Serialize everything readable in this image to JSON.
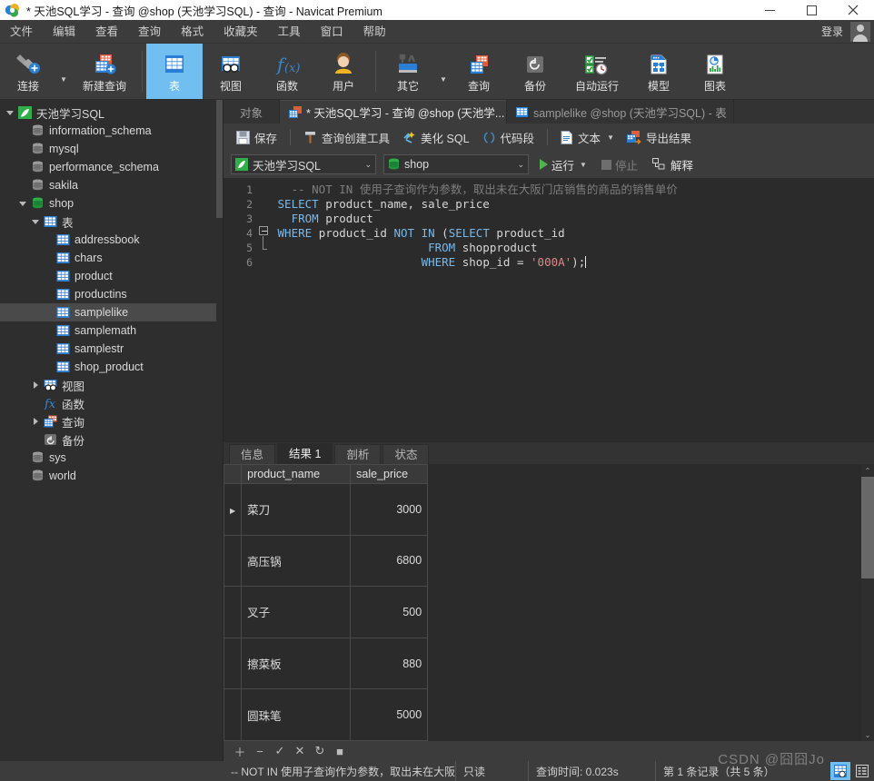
{
  "window": {
    "title": "* 天池SQL学习 - 查询 @shop (天池学习SQL) - 查询 - Navicat Premium",
    "minimize_label": "—",
    "maximize_label": "☐",
    "close_label": "✕"
  },
  "menubar": {
    "items": [
      {
        "label": "文件"
      },
      {
        "label": "编辑"
      },
      {
        "label": "查看"
      },
      {
        "label": "查询"
      },
      {
        "label": "格式"
      },
      {
        "label": "收藏夹"
      },
      {
        "label": "工具"
      },
      {
        "label": "窗口"
      },
      {
        "label": "帮助"
      }
    ],
    "login_label": "登录"
  },
  "main_toolbar": {
    "items": [
      {
        "label": "连接",
        "icon": "connection-icon",
        "has_caret": true,
        "active": false
      },
      {
        "label": "新建查询",
        "icon": "new-query-icon",
        "has_caret": false,
        "active": false
      },
      {
        "label": "表",
        "icon": "table-icon",
        "has_caret": false,
        "active": true
      },
      {
        "label": "视图",
        "icon": "view-icon",
        "has_caret": false,
        "active": false
      },
      {
        "label": "函数",
        "icon": "function-icon",
        "has_caret": false,
        "active": false
      },
      {
        "label": "用户",
        "icon": "user-icon",
        "has_caret": false,
        "active": false
      },
      {
        "label": "其它",
        "icon": "other-icon",
        "has_caret": true,
        "active": false
      },
      {
        "label": "查询",
        "icon": "query-icon",
        "has_caret": false,
        "active": false
      },
      {
        "label": "备份",
        "icon": "backup-icon",
        "has_caret": false,
        "active": false
      },
      {
        "label": "自动运行",
        "icon": "automation-icon",
        "has_caret": false,
        "active": false
      },
      {
        "label": "模型",
        "icon": "model-icon",
        "has_caret": false,
        "active": false
      },
      {
        "label": "图表",
        "icon": "chart-icon",
        "has_caret": false,
        "active": false
      }
    ]
  },
  "sidebar": {
    "tree": [
      {
        "label": "天池学习SQL",
        "depth": 0,
        "icon": "connection-leaf-icon",
        "twisty": "open",
        "selected": false
      },
      {
        "label": "information_schema",
        "depth": 1,
        "icon": "database-gray-icon",
        "twisty": "",
        "selected": false
      },
      {
        "label": "mysql",
        "depth": 1,
        "icon": "database-gray-icon",
        "twisty": "",
        "selected": false
      },
      {
        "label": "performance_schema",
        "depth": 1,
        "icon": "database-gray-icon",
        "twisty": "",
        "selected": false
      },
      {
        "label": "sakila",
        "depth": 1,
        "icon": "database-gray-icon",
        "twisty": "",
        "selected": false
      },
      {
        "label": "shop",
        "depth": 1,
        "icon": "database-green-icon",
        "twisty": "open",
        "selected": false
      },
      {
        "label": "表",
        "depth": 2,
        "icon": "tables-folder-icon",
        "twisty": "open",
        "selected": false
      },
      {
        "label": "addressbook",
        "depth": 3,
        "icon": "table-blue-icon",
        "twisty": "",
        "selected": false
      },
      {
        "label": "chars",
        "depth": 3,
        "icon": "table-blue-icon",
        "twisty": "",
        "selected": false
      },
      {
        "label": "product",
        "depth": 3,
        "icon": "table-blue-icon",
        "twisty": "",
        "selected": false
      },
      {
        "label": "productins",
        "depth": 3,
        "icon": "table-blue-icon",
        "twisty": "",
        "selected": false
      },
      {
        "label": "samplelike",
        "depth": 3,
        "icon": "table-blue-icon",
        "twisty": "",
        "selected": true
      },
      {
        "label": "samplemath",
        "depth": 3,
        "icon": "table-blue-icon",
        "twisty": "",
        "selected": false
      },
      {
        "label": "samplestr",
        "depth": 3,
        "icon": "table-blue-icon",
        "twisty": "",
        "selected": false
      },
      {
        "label": "shop_product",
        "depth": 3,
        "icon": "table-blue-icon",
        "twisty": "",
        "selected": false
      },
      {
        "label": "视图",
        "depth": 2,
        "icon": "views-folder-icon",
        "twisty": "closed",
        "selected": false
      },
      {
        "label": "函数",
        "depth": 2,
        "icon": "functions-folder-icon",
        "twisty": "",
        "selected": false
      },
      {
        "label": "查询",
        "depth": 2,
        "icon": "queries-folder-icon",
        "twisty": "closed",
        "selected": false
      },
      {
        "label": "备份",
        "depth": 2,
        "icon": "backup-folder-icon",
        "twisty": "",
        "selected": false
      },
      {
        "label": "sys",
        "depth": 1,
        "icon": "database-gray-icon",
        "twisty": "",
        "selected": false
      },
      {
        "label": "world",
        "depth": 1,
        "icon": "database-gray-icon",
        "twisty": "",
        "selected": false
      }
    ]
  },
  "doc_tabs": {
    "object_label": "对象",
    "tabs": [
      {
        "label": "* 天池SQL学习 - 查询 @shop (天池学...",
        "icon": "query-tab-icon",
        "active": true
      },
      {
        "label": "samplelike @shop (天池学习SQL) - 表",
        "icon": "table-tab-icon",
        "active": false
      }
    ]
  },
  "editor_toolbar": {
    "save_label": "保存",
    "query_builder_label": "查询创建工具",
    "beautify_label": "美化 SQL",
    "snippet_label": "代码段",
    "text_label": "文本",
    "export_label": "导出结果"
  },
  "connection_bar": {
    "connection_value": "天池学习SQL",
    "database_value": "shop",
    "run_label": "运行",
    "stop_label": "停止",
    "explain_label": "解释"
  },
  "editor": {
    "line_numbers": [
      "1",
      "2",
      "3",
      "4",
      "5",
      "6"
    ],
    "lines": [
      {
        "n": "1",
        "segments": [
          {
            "t": "   -- NOT IN 使用子查询作为参数，取出未在大阪门店销售的商品的销售单价",
            "c": "cm"
          }
        ]
      },
      {
        "n": "2",
        "segments": [
          {
            "t": " ",
            "c": ""
          },
          {
            "t": "SELECT",
            "c": "kw"
          },
          {
            "t": " product_name, sale_price",
            "c": ""
          }
        ]
      },
      {
        "n": "3",
        "segments": [
          {
            "t": "   ",
            "c": ""
          },
          {
            "t": "FROM",
            "c": "kw"
          },
          {
            "t": " product",
            "c": ""
          }
        ]
      },
      {
        "n": "4",
        "segments": [
          {
            "t": " ",
            "c": ""
          },
          {
            "t": "WHERE",
            "c": "kw"
          },
          {
            "t": " product_id ",
            "c": ""
          },
          {
            "t": "NOT IN",
            "c": "kw"
          },
          {
            "t": " (",
            "c": ""
          },
          {
            "t": "SELECT",
            "c": "kw"
          },
          {
            "t": " product_id",
            "c": ""
          }
        ]
      },
      {
        "n": "5",
        "segments": [
          {
            "t": "                       ",
            "c": ""
          },
          {
            "t": "FROM",
            "c": "kw"
          },
          {
            "t": " shopproduct",
            "c": ""
          }
        ]
      },
      {
        "n": "6",
        "segments": [
          {
            "t": "                      ",
            "c": ""
          },
          {
            "t": "WHERE",
            "c": "kw"
          },
          {
            "t": " shop_id = ",
            "c": ""
          },
          {
            "t": "'000A'",
            "c": "str"
          },
          {
            "t": ");",
            "c": ""
          }
        ]
      }
    ]
  },
  "results": {
    "tabs": [
      {
        "label": "信息",
        "active": false
      },
      {
        "label": "结果 1",
        "active": true
      },
      {
        "label": "剖析",
        "active": false
      },
      {
        "label": "状态",
        "active": false
      }
    ],
    "columns": [
      "product_name",
      "sale_price"
    ],
    "rows": [
      {
        "product_name": "菜刀",
        "sale_price": "3000",
        "current": true
      },
      {
        "product_name": "高压锅",
        "sale_price": "6800",
        "current": false
      },
      {
        "product_name": "叉子",
        "sale_price": "500",
        "current": false
      },
      {
        "product_name": "擦菜板",
        "sale_price": "880",
        "current": false
      },
      {
        "product_name": "圆珠笔",
        "sale_price": "5000",
        "current": false
      }
    ]
  },
  "grid_toolbar": {
    "buttons": [
      {
        "icon": "add-record-icon",
        "glyph": "＋"
      },
      {
        "icon": "remove-record-icon",
        "glyph": "−"
      },
      {
        "icon": "apply-change-icon",
        "glyph": "✓"
      },
      {
        "icon": "cancel-change-icon",
        "glyph": "✕"
      },
      {
        "icon": "refresh-icon",
        "glyph": "↻"
      },
      {
        "icon": "stop-icon",
        "glyph": "■"
      }
    ]
  },
  "statusbar": {
    "query_text": "-- NOT IN 使用子查询作为参数，取出未在大阪",
    "readonly_label": "只读",
    "query_time_label": "查询时间: 0.023s",
    "record_label": "第 1 条记录（共 5 条）",
    "grid_view_icon": "grid-view-icon",
    "form_view_icon": "form-view-icon"
  },
  "watermark": {
    "text": "CSDN @囧囧Jo"
  },
  "colors": {
    "accent": "#71bef0",
    "toolbar_bg": "#3c3c3c",
    "editor_bg": "#2b2b2b",
    "sidebar_bg": "#2e2e2e",
    "selection_blue": "#1668d1",
    "run_green": "#53b353"
  }
}
